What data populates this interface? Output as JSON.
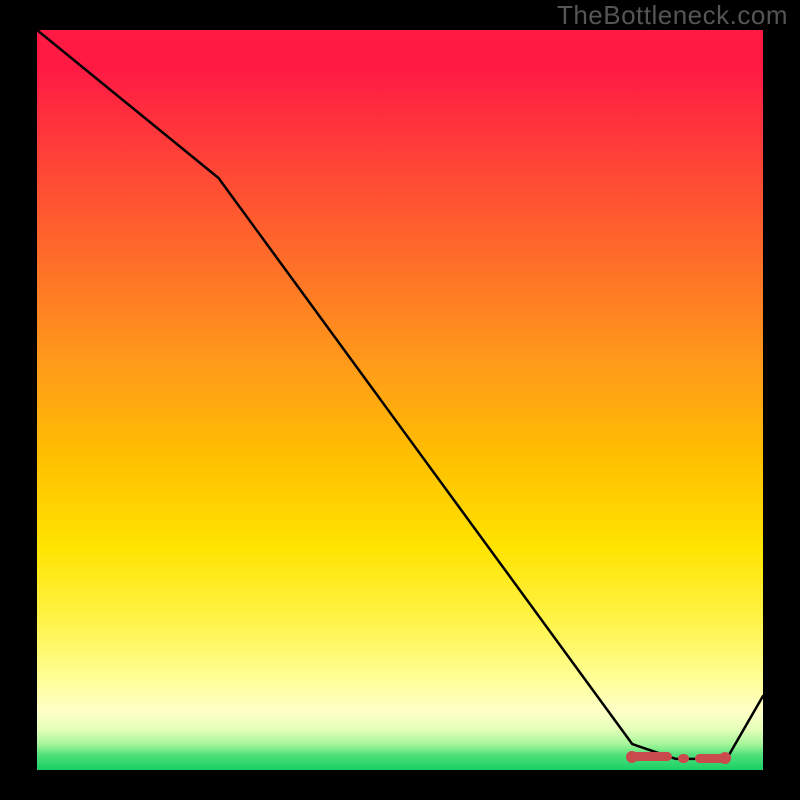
{
  "watermark": "TheBottleneck.com",
  "colors": {
    "background": "#000000",
    "gradient_top": "#ff1a44",
    "gradient_bottom": "#18cf65",
    "line": "#000000",
    "marker": "#c94b4e",
    "watermark": "#555555"
  },
  "chart_data": {
    "type": "line",
    "title": "",
    "xlabel": "",
    "ylabel": "",
    "xlim": [
      0,
      100
    ],
    "ylim": [
      0,
      100
    ],
    "series": [
      {
        "name": "curve",
        "x": [
          0,
          25,
          82,
          88,
          95,
          100
        ],
        "y": [
          100,
          80,
          3.5,
          1.5,
          1.5,
          10
        ]
      }
    ],
    "markers": {
      "name": "optimal-zone",
      "segments": [
        {
          "x0": 82,
          "x1": 87.5,
          "y": 1.8
        },
        {
          "x0": 88.3,
          "x1": 89.8,
          "y": 1.6
        },
        {
          "x0": 90.6,
          "x1": 94.8,
          "y": 1.6
        }
      ],
      "endpoints": [
        {
          "x": 82,
          "y": 1.8
        },
        {
          "x": 94.8,
          "y": 1.6
        }
      ]
    },
    "background_gradient": {
      "orientation": "vertical",
      "stops": [
        {
          "pos": 0.0,
          "color": "#ff1a44"
        },
        {
          "pos": 0.3,
          "color": "#ff6a2a"
        },
        {
          "pos": 0.58,
          "color": "#ffc000"
        },
        {
          "pos": 0.8,
          "color": "#fff44a"
        },
        {
          "pos": 0.94,
          "color": "#e4ffb8"
        },
        {
          "pos": 1.0,
          "color": "#18cf65"
        }
      ]
    }
  }
}
